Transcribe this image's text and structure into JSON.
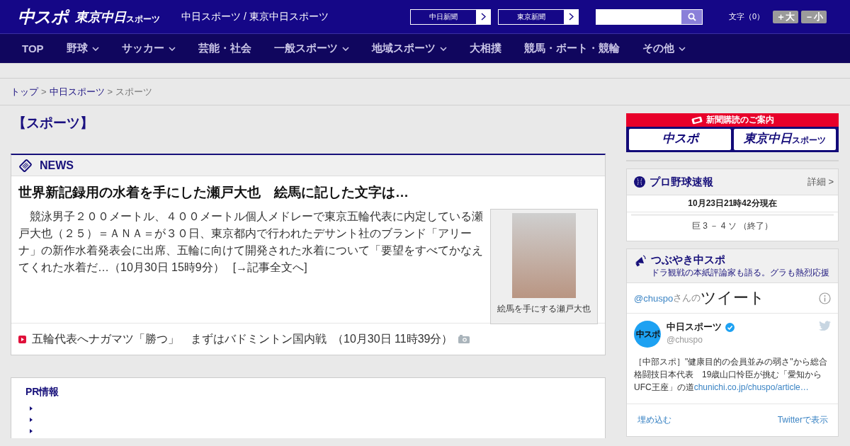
{
  "header": {
    "logo": "中スポ",
    "logo_tokyo": {
      "main": "東京中日",
      "small": "スポーツ"
    },
    "site_names": "中日スポーツ / 東京中日スポーツ",
    "paper_links": [
      "中日新聞",
      "東京新聞"
    ],
    "font_size": {
      "label": "文字（0）",
      "buttons": [
        "＋大",
        "－小"
      ]
    }
  },
  "nav": [
    {
      "label": "TOP",
      "has_menu": false
    },
    {
      "label": "野球",
      "has_menu": true
    },
    {
      "label": "サッカー",
      "has_menu": true
    },
    {
      "label": "芸能・社会",
      "has_menu": false
    },
    {
      "label": "一般スポーツ",
      "has_menu": true
    },
    {
      "label": "地域スポーツ",
      "has_menu": true
    },
    {
      "label": "大相撲",
      "has_menu": false
    },
    {
      "label": "競馬・ボート・競輪",
      "has_menu": false
    },
    {
      "label": "その他",
      "has_menu": true
    }
  ],
  "breadcrumb": {
    "items": [
      {
        "label": "トップ",
        "current": false
      },
      {
        "label": "中日スポーツ",
        "current": false
      },
      {
        "label": "スポーツ",
        "current": true
      }
    ],
    "separators": [
      ">",
      ">"
    ]
  },
  "page_title": "【スポーツ】",
  "news": {
    "heading": "NEWS",
    "lead": {
      "title": "世界新記録用の水着を手にした瀬戸大也　絵馬に記した文字は…",
      "body": "　競泳男子２００メートル、４００メートル個人メドレーで東京五輪代表に内定している瀬戸大也（２５）＝ＡＮＡ＝が３０日、東京都内で行われたデサント社のブランド「アリーナ」の新作水着発表会に出席、五輪に向けて開発された水着について「要望をすべてかなえてくれた水着だ…（10月30日 15時9分）",
      "more_link": "[→記事全文へ]",
      "photo_caption": "絵馬を手にする瀬戸大也"
    },
    "items": [
      {
        "title": "五輪代表へナガマツ「勝つ」　まずはバドミントン国内戦",
        "time": "（10月30日 11時39分）",
        "has_photo": true
      }
    ]
  },
  "pr": {
    "heading": "PR情報"
  },
  "side": {
    "subscription": {
      "heading": "新聞購読のご案内",
      "logo": "中スポ",
      "logo_tokyo": {
        "main": "東京中日",
        "small": "スポーツ"
      }
    },
    "baseball": {
      "title": "プロ野球速報",
      "detail": "詳細 >",
      "time": "10月23日21時42分現在",
      "games": [
        "巨 3 － 4 ソ （終了）"
      ]
    },
    "tweets": {
      "title": "つぶやき中スポ",
      "subtitle": "ドラ観戦の本紙評論家も語る。グラも熱烈応援",
      "handle": "@chuspo",
      "handle_suffix": "さんの",
      "heading": "ツイート",
      "tweet": {
        "avatar_text": "中スポ",
        "name": "中日スポーツ",
        "verified": true,
        "user": "@chuspo",
        "text": "［中部スポ］\"健康目的の会員並みの弱さ\"から総合格闘技日本代表　19歳山口怜臣が挑む「愛知から UFC王座」の道",
        "link": "chunichi.co.jp/chuspo/article…"
      },
      "footer": [
        "埋め込む",
        "Twitterで表示"
      ]
    }
  }
}
